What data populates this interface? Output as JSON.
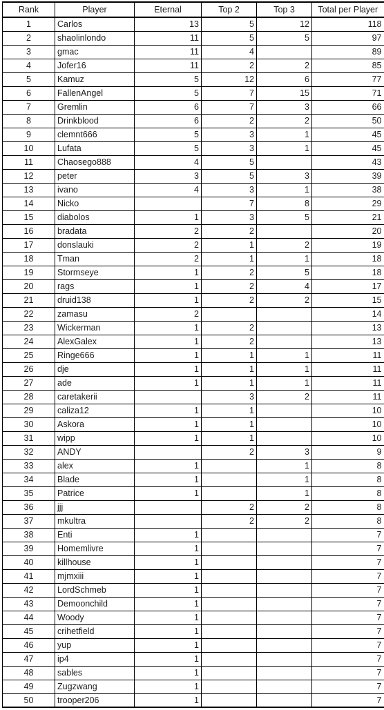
{
  "table": {
    "name": "player-ranking-table",
    "columns": [
      {
        "key": "rank",
        "label": "Rank",
        "align": "center"
      },
      {
        "key": "player",
        "label": "Player",
        "align": "left"
      },
      {
        "key": "eternal",
        "label": "Eternal",
        "align": "right"
      },
      {
        "key": "top2",
        "label": "Top 2",
        "align": "right"
      },
      {
        "key": "top3",
        "label": "Top 3",
        "align": "right"
      },
      {
        "key": "total",
        "label": "Total per Player",
        "align": "right"
      }
    ],
    "rows": [
      {
        "rank": "1",
        "player": "Carlos",
        "eternal": "13",
        "top2": "5",
        "top3": "12",
        "total": "118"
      },
      {
        "rank": "2",
        "player": "shaolinlondo",
        "eternal": "11",
        "top2": "5",
        "top3": "5",
        "total": "97"
      },
      {
        "rank": "3",
        "player": "gmac",
        "eternal": "11",
        "top2": "4",
        "top3": "",
        "total": "89"
      },
      {
        "rank": "4",
        "player": "Jofer16",
        "eternal": "11",
        "top2": "2",
        "top3": "2",
        "total": "85"
      },
      {
        "rank": "5",
        "player": "Kamuz",
        "eternal": "5",
        "top2": "12",
        "top3": "6",
        "total": "77"
      },
      {
        "rank": "6",
        "player": "FallenAngel",
        "eternal": "5",
        "top2": "7",
        "top3": "15",
        "total": "71"
      },
      {
        "rank": "7",
        "player": "Gremlin",
        "eternal": "6",
        "top2": "7",
        "top3": "3",
        "total": "66"
      },
      {
        "rank": "8",
        "player": "Drinkblood",
        "eternal": "6",
        "top2": "2",
        "top3": "2",
        "total": "50"
      },
      {
        "rank": "9",
        "player": "clemnt666",
        "eternal": "5",
        "top2": "3",
        "top3": "1",
        "total": "45"
      },
      {
        "rank": "10",
        "player": "Lufata",
        "eternal": "5",
        "top2": "3",
        "top3": "1",
        "total": "45"
      },
      {
        "rank": "11",
        "player": "Chaosego888",
        "eternal": "4",
        "top2": "5",
        "top3": "",
        "total": "43"
      },
      {
        "rank": "12",
        "player": "peter",
        "eternal": "3",
        "top2": "5",
        "top3": "3",
        "total": "39"
      },
      {
        "rank": "13",
        "player": "ivano",
        "eternal": "4",
        "top2": "3",
        "top3": "1",
        "total": "38"
      },
      {
        "rank": "14",
        "player": "Nicko",
        "eternal": "",
        "top2": "7",
        "top3": "8",
        "total": "29"
      },
      {
        "rank": "15",
        "player": "diabolos",
        "eternal": "1",
        "top2": "3",
        "top3": "5",
        "total": "21"
      },
      {
        "rank": "16",
        "player": "bradata",
        "eternal": "2",
        "top2": "2",
        "top3": "",
        "total": "20"
      },
      {
        "rank": "17",
        "player": "donslauki",
        "eternal": "2",
        "top2": "1",
        "top3": "2",
        "total": "19"
      },
      {
        "rank": "18",
        "player": "Tman",
        "eternal": "2",
        "top2": "1",
        "top3": "1",
        "total": "18"
      },
      {
        "rank": "19",
        "player": "Stormseye",
        "eternal": "1",
        "top2": "2",
        "top3": "5",
        "total": "18"
      },
      {
        "rank": "20",
        "player": "rags",
        "eternal": "1",
        "top2": "2",
        "top3": "4",
        "total": "17"
      },
      {
        "rank": "21",
        "player": "druid138",
        "eternal": "1",
        "top2": "2",
        "top3": "2",
        "total": "15"
      },
      {
        "rank": "22",
        "player": "zamasu",
        "eternal": "2",
        "top2": "",
        "top3": "",
        "total": "14"
      },
      {
        "rank": "23",
        "player": "Wickerman",
        "eternal": "1",
        "top2": "2",
        "top3": "",
        "total": "13"
      },
      {
        "rank": "24",
        "player": "AlexGalex",
        "eternal": "1",
        "top2": "2",
        "top3": "",
        "total": "13"
      },
      {
        "rank": "25",
        "player": "Ringe666",
        "eternal": "1",
        "top2": "1",
        "top3": "1",
        "total": "11"
      },
      {
        "rank": "26",
        "player": "dje",
        "eternal": "1",
        "top2": "1",
        "top3": "1",
        "total": "11"
      },
      {
        "rank": "27",
        "player": "ade",
        "eternal": "1",
        "top2": "1",
        "top3": "1",
        "total": "11"
      },
      {
        "rank": "28",
        "player": "caretakerii",
        "eternal": "",
        "top2": "3",
        "top3": "2",
        "total": "11"
      },
      {
        "rank": "29",
        "player": "caliza12",
        "eternal": "1",
        "top2": "1",
        "top3": "",
        "total": "10"
      },
      {
        "rank": "30",
        "player": "Askora",
        "eternal": "1",
        "top2": "1",
        "top3": "",
        "total": "10"
      },
      {
        "rank": "31",
        "player": "wipp",
        "eternal": "1",
        "top2": "1",
        "top3": "",
        "total": "10"
      },
      {
        "rank": "32",
        "player": "ANDY",
        "eternal": "",
        "top2": "2",
        "top3": "3",
        "total": "9"
      },
      {
        "rank": "33",
        "player": "alex",
        "eternal": "1",
        "top2": "",
        "top3": "1",
        "total": "8"
      },
      {
        "rank": "34",
        "player": "Blade",
        "eternal": "1",
        "top2": "",
        "top3": "1",
        "total": "8"
      },
      {
        "rank": "35",
        "player": "Patrice",
        "eternal": "1",
        "top2": "",
        "top3": "1",
        "total": "8"
      },
      {
        "rank": "36",
        "player": "jjj",
        "eternal": "",
        "top2": "2",
        "top3": "2",
        "total": "8"
      },
      {
        "rank": "37",
        "player": "mkultra",
        "eternal": "",
        "top2": "2",
        "top3": "2",
        "total": "8"
      },
      {
        "rank": "38",
        "player": "Enti",
        "eternal": "1",
        "top2": "",
        "top3": "",
        "total": "7"
      },
      {
        "rank": "39",
        "player": "Homemlivre",
        "eternal": "1",
        "top2": "",
        "top3": "",
        "total": "7"
      },
      {
        "rank": "40",
        "player": "killhouse",
        "eternal": "1",
        "top2": "",
        "top3": "",
        "total": "7"
      },
      {
        "rank": "41",
        "player": "mjmxiii",
        "eternal": "1",
        "top2": "",
        "top3": "",
        "total": "7"
      },
      {
        "rank": "42",
        "player": "LordSchmeb",
        "eternal": "1",
        "top2": "",
        "top3": "",
        "total": "7"
      },
      {
        "rank": "43",
        "player": "Demoonchild",
        "eternal": "1",
        "top2": "",
        "top3": "",
        "total": "7"
      },
      {
        "rank": "44",
        "player": "Woody",
        "eternal": "1",
        "top2": "",
        "top3": "",
        "total": "7"
      },
      {
        "rank": "45",
        "player": "crihetfield",
        "eternal": "1",
        "top2": "",
        "top3": "",
        "total": "7"
      },
      {
        "rank": "46",
        "player": "yup",
        "eternal": "1",
        "top2": "",
        "top3": "",
        "total": "7"
      },
      {
        "rank": "47",
        "player": "ip4",
        "eternal": "1",
        "top2": "",
        "top3": "",
        "total": "7"
      },
      {
        "rank": "48",
        "player": "sables",
        "eternal": "1",
        "top2": "",
        "top3": "",
        "total": "7"
      },
      {
        "rank": "49",
        "player": "Zugzwang",
        "eternal": "1",
        "top2": "",
        "top3": "",
        "total": "7"
      },
      {
        "rank": "50",
        "player": "trooper206",
        "eternal": "1",
        "top2": "",
        "top3": "",
        "total": "7"
      }
    ]
  },
  "style": {
    "border_color": "#000000",
    "text_color": "#1c1c1c",
    "background": "#ffffff"
  }
}
